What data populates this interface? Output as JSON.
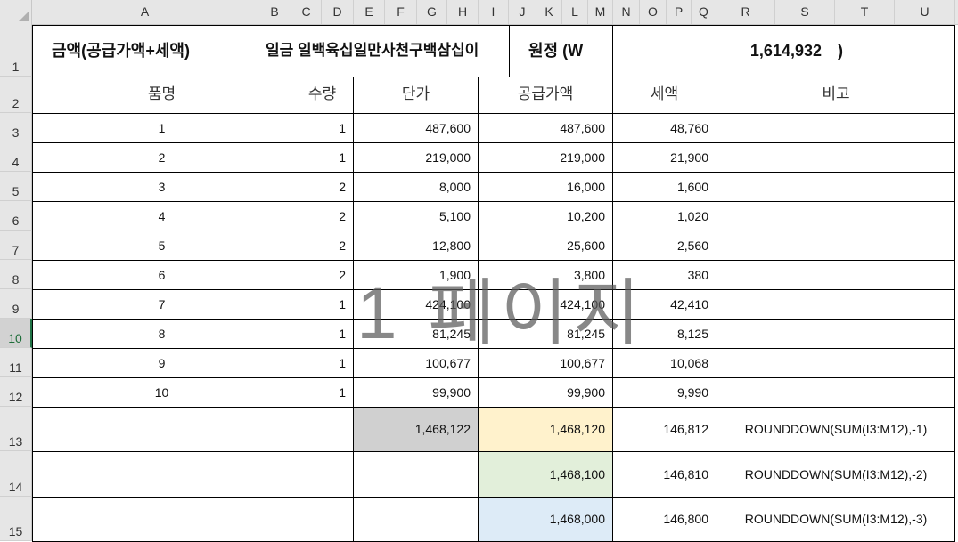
{
  "columns": [
    "A",
    "B",
    "C",
    "D",
    "E",
    "F",
    "G",
    "H",
    "I",
    "J",
    "K",
    "L",
    "M",
    "N",
    "O",
    "P",
    "Q",
    "R",
    "S",
    "T",
    "U"
  ],
  "rows": [
    "1",
    "2",
    "3",
    "4",
    "5",
    "6",
    "7",
    "8",
    "9",
    "10",
    "11",
    "12",
    "13",
    "14",
    "15"
  ],
  "selected_row": "10",
  "title_row": {
    "label": "금액(공급가액+세액)",
    "korean_amount": "일금  일백육십일만사천구백삼십이",
    "won_label": "원정 (W",
    "amount": "1,614,932",
    "close_paren": ")"
  },
  "headers": {
    "name": "품명",
    "qty": "수량",
    "unit_price": "단가",
    "supply": "공급가액",
    "tax": "세액",
    "note": "비고"
  },
  "items": [
    {
      "name": "1",
      "qty": "1",
      "unit": "487,600",
      "supply": "487,600",
      "tax": "48,760"
    },
    {
      "name": "2",
      "qty": "1",
      "unit": "219,000",
      "supply": "219,000",
      "tax": "21,900"
    },
    {
      "name": "3",
      "qty": "2",
      "unit": "8,000",
      "supply": "16,000",
      "tax": "1,600"
    },
    {
      "name": "4",
      "qty": "2",
      "unit": "5,100",
      "supply": "10,200",
      "tax": "1,020"
    },
    {
      "name": "5",
      "qty": "2",
      "unit": "12,800",
      "supply": "25,600",
      "tax": "2,560"
    },
    {
      "name": "6",
      "qty": "2",
      "unit": "1,900",
      "supply": "3,800",
      "tax": "380"
    },
    {
      "name": "7",
      "qty": "1",
      "unit": "424,100",
      "supply": "424,100",
      "tax": "42,410"
    },
    {
      "name": "8",
      "qty": "1",
      "unit": "81,245",
      "supply": "81,245",
      "tax": "8,125"
    },
    {
      "name": "9",
      "qty": "1",
      "unit": "100,677",
      "supply": "100,677",
      "tax": "10,068"
    },
    {
      "name": "10",
      "qty": "1",
      "unit": "99,900",
      "supply": "99,900",
      "tax": "9,990"
    }
  ],
  "totals": [
    {
      "unit": "1,468,122",
      "supply": "1,468,120",
      "tax": "146,812",
      "note": "ROUNDDOWN(SUM(I3:M12),-1)"
    },
    {
      "unit": "",
      "supply": "1,468,100",
      "tax": "146,810",
      "note": "ROUNDDOWN(SUM(I3:M12),-2)"
    },
    {
      "unit": "",
      "supply": "1,468,000",
      "tax": "146,800",
      "note": "ROUNDDOWN(SUM(I3:M12),-3)"
    }
  ],
  "fills": {
    "unit_total": "#d0d0d0",
    "supply_total_1": "#fff2cc",
    "supply_total_2": "#e2efda",
    "supply_total_3": "#ddebf7"
  },
  "watermark": "1 페이지"
}
